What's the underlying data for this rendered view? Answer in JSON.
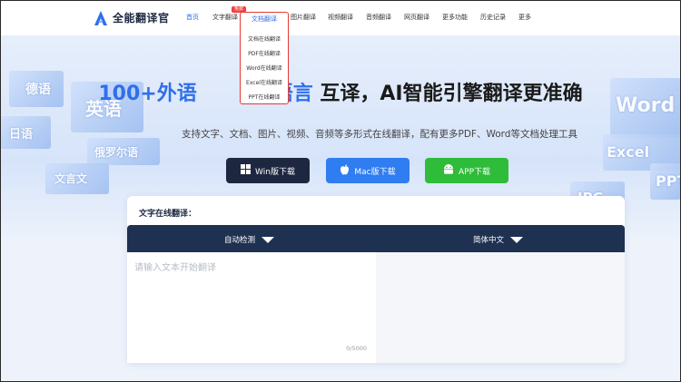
{
  "app": {
    "name": "全能翻译官",
    "accent": "#2f6fec"
  },
  "nav": {
    "items": [
      {
        "label": "首页",
        "active": true
      },
      {
        "label": "文字翻译",
        "active": false
      },
      {
        "label": "文档翻译",
        "active": true
      },
      {
        "label": "图片翻译",
        "active": false
      },
      {
        "label": "视频翻译",
        "active": false
      },
      {
        "label": "音频翻译",
        "active": false
      },
      {
        "label": "网页翻译",
        "active": false
      },
      {
        "label": "更多功能",
        "active": false
      },
      {
        "label": "历史记录",
        "active": false
      },
      {
        "label": "更多",
        "active": false
      }
    ],
    "hot_badge": "免费"
  },
  "dropdown": {
    "items": [
      "文档在线翻译",
      "PDF在线翻译",
      "Word在线翻译",
      "Excel在线翻译",
      "PPT在线翻译"
    ]
  },
  "hero": {
    "headline_a": "100+外语",
    "headline_b": "族语言",
    "headline_c": "互译，AI智能引擎翻译更准确",
    "subline": "支持文字、文档、图片、视频、音频等多形式在线翻译，配有更多PDF、Word等文档处理工具",
    "cards_left": [
      "德语",
      "英语",
      "日语",
      "俄罗尔语",
      "文言文"
    ],
    "cards_right": [
      "Word",
      "Excel",
      "PPT",
      "JPG"
    ]
  },
  "downloads": {
    "win_label": "Win版下载",
    "mac_label": "Mac版下载",
    "app_label": "APP下载"
  },
  "translator": {
    "title": "文字在线翻译：",
    "source_lang": "自动检测",
    "target_lang": "简体中文",
    "placeholder": "请输入文本开始翻译",
    "counter": "0/5000"
  }
}
